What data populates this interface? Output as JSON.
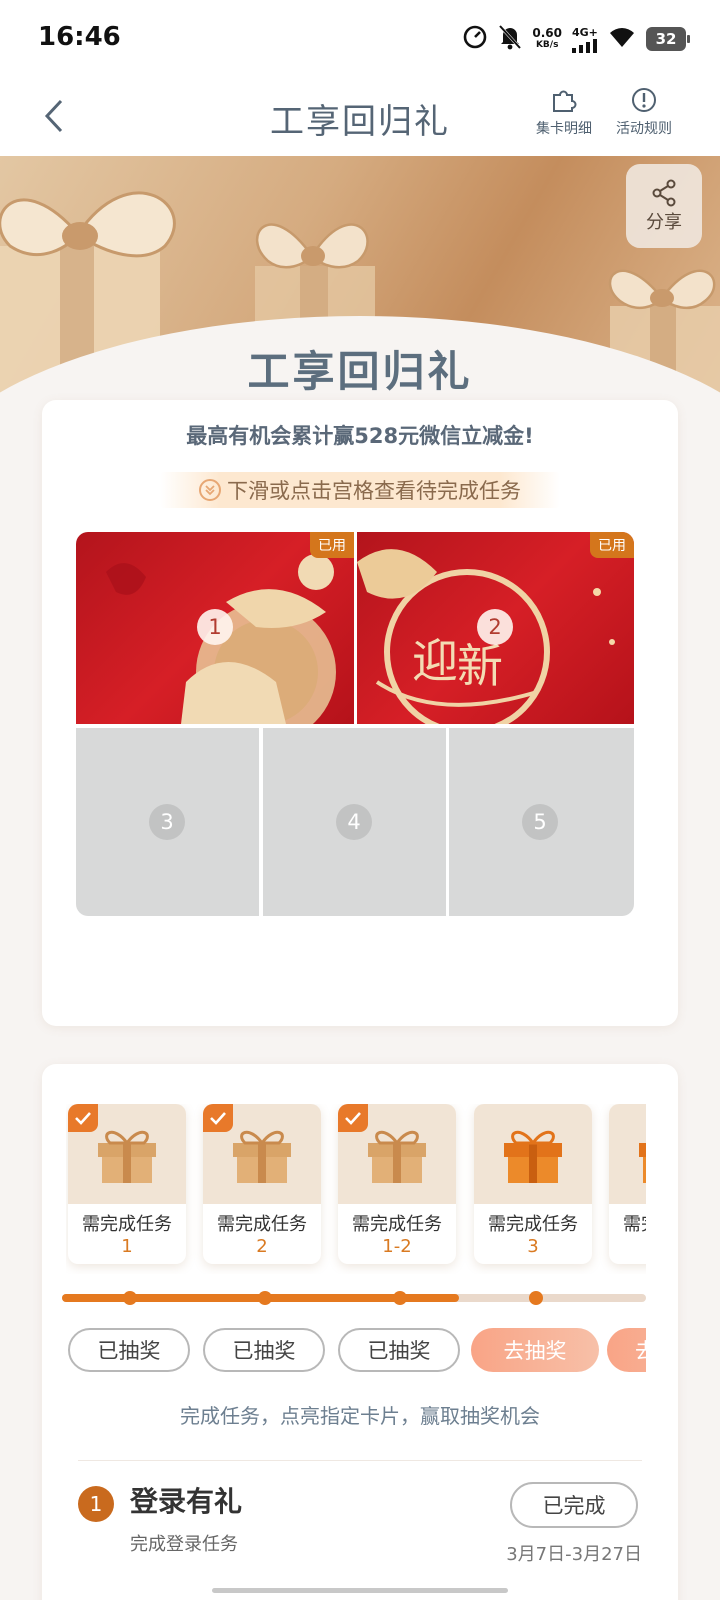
{
  "status_bar": {
    "time": "16:46",
    "speed_value": "0.60",
    "speed_unit": "KB/s",
    "network": "4G+",
    "battery": "32"
  },
  "nav": {
    "title": "工享回归礼",
    "card_detail_label": "集卡明细",
    "rules_label": "活动规则"
  },
  "hero": {
    "title": "工享回归礼",
    "share_label": "分享"
  },
  "grid_card": {
    "headline": "最高有机会累计赢528元微信立减金!",
    "hint": "下滑或点击宫格查看待完成任务",
    "used_tag": "已用",
    "cells": [
      {
        "num": "1",
        "used": true
      },
      {
        "num": "2",
        "used": true
      },
      {
        "num": "3",
        "used": false
      },
      {
        "num": "4",
        "used": false
      },
      {
        "num": "5",
        "used": false
      }
    ]
  },
  "rewards": {
    "gifts": [
      {
        "label": "需完成任务",
        "sub": "1",
        "checked": true
      },
      {
        "label": "需完成任务",
        "sub": "2",
        "checked": true
      },
      {
        "label": "需完成任务",
        "sub": "1-2",
        "checked": true
      },
      {
        "label": "需完成任务",
        "sub": "3",
        "checked": false
      },
      {
        "label": "需完成任务",
        "sub": "",
        "checked": false
      }
    ],
    "progress_fraction": 0.68,
    "buttons": [
      "已抽奖",
      "已抽奖",
      "已抽奖",
      "去抽奖",
      "去抽奖"
    ],
    "tip": "完成任务，点亮指定卡片，赢取抽奖机会"
  },
  "task": {
    "num": "1",
    "title": "登录有礼",
    "desc": "完成登录任务",
    "button": "已完成",
    "date": "3月7日-3月27日"
  },
  "colors": {
    "accent": "#e5791f",
    "title_gray": "#556575",
    "red": "#c8161d"
  }
}
